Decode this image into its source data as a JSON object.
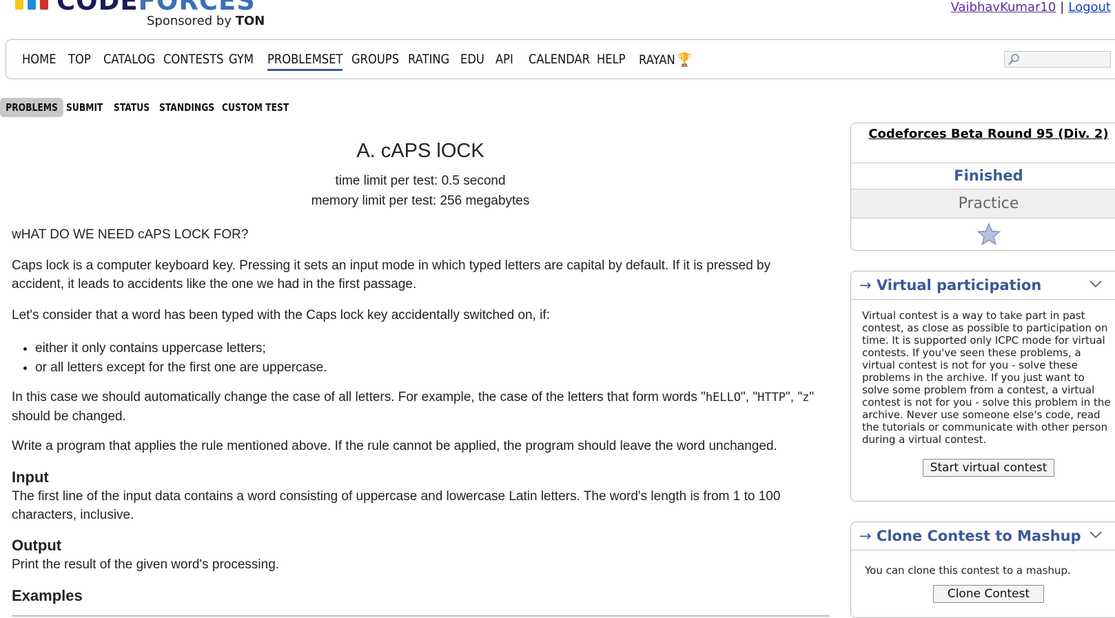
{
  "header": {
    "logo_word_code": "CODE",
    "logo_word_forces": "FORCES",
    "sponsor_prefix": "Sponsored by",
    "sponsor_name": "TON",
    "username": "VaibhavKumar10",
    "separator": "|",
    "logout": "Logout"
  },
  "menu": {
    "items": [
      "HOME",
      "TOP",
      "CATALOG",
      "CONTESTS",
      "GYM",
      "PROBLEMSET",
      "GROUPS",
      "RATING",
      "EDU",
      "API",
      "CALENDAR",
      "HELP",
      "RAYAN"
    ],
    "active": "PROBLEMSET",
    "trophy_icon": "trophy-icon",
    "search_icon": "search-icon",
    "search_value": ""
  },
  "submenu": {
    "items": [
      "PROBLEMS",
      "SUBMIT",
      "STATUS",
      "STANDINGS",
      "CUSTOM TEST"
    ],
    "active": "PROBLEMS"
  },
  "problem": {
    "title": "A. cAPS lOCK",
    "time_limit": "time limit per test: 0.5 second",
    "memory_limit": "memory limit per test: 256 megabytes",
    "intro": "wHAT DO WE NEED cAPS LOCK FOR?",
    "para1": "Caps lock is a computer keyboard key. Pressing it sets an input mode in which typed letters are capital by default. If it is pressed by accident, it leads to accidents like the one we had in the first passage.",
    "para2": "Let's consider that a word has been typed with the Caps lock key accidentally switched on, if:",
    "bullets": [
      "either it only contains uppercase letters;",
      "or all letters except for the first one are uppercase."
    ],
    "para3_a": "In this case we should automatically change the case of all letters. For example, the case of the letters that form words \"",
    "para3_w1": "hELLO",
    "para3_b": "\", \"",
    "para3_w2": "HTTP",
    "para3_c": "\", \"",
    "para3_w3": "z",
    "para3_d": "\" should be changed.",
    "para4": "Write a program that applies the rule mentioned above. If the rule cannot be applied, the program should leave the word unchanged.",
    "input_title": "Input",
    "input_text": "The first line of the input data contains a word consisting of uppercase and lowercase Latin letters. The word's length is from 1 to 100 characters, inclusive.",
    "output_title": "Output",
    "output_text": "Print the result of the given word's processing.",
    "examples_title": "Examples"
  },
  "sidebar": {
    "contest_name": "Codeforces Beta Round 95 (Div. 2)",
    "contest_status": "Finished",
    "contest_phase": "Practice",
    "star_icon": "star-icon",
    "virtual": {
      "arrow": "→",
      "title": "Virtual participation",
      "text": "Virtual contest is a way to take part in past contest, as close as possible to participation on time. It is supported only ICPC mode for virtual contests. If you've seen these problems, a virtual contest is not for you - solve these problems in the archive. If you just want to solve some problem from a contest, a virtual contest is not for you - solve this problem in the archive. Never use someone else's code, read the tutorials or communicate with other person during a virtual contest.",
      "button": "Start virtual contest"
    },
    "clone": {
      "arrow": "→",
      "title": "Clone Contest to Mashup",
      "text": "You can clone this contest to a mashup.",
      "button": "Clone Contest"
    }
  },
  "colors": {
    "accent": "#3b5998",
    "logo_yellow": "#f5c518",
    "logo_blue": "#1a8cd8",
    "logo_red": "#d32f2f"
  }
}
